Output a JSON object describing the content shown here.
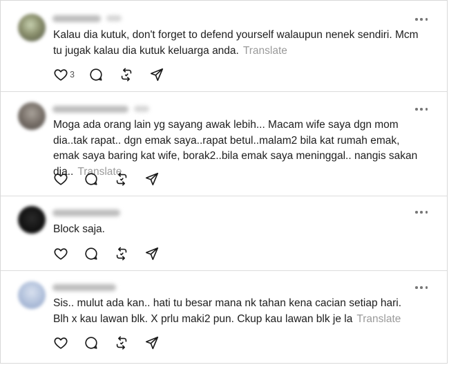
{
  "comments": [
    {
      "text": "Kalau dia kutuk, don't forget to defend yourself walaupun nenek sendiri. Mcm tu jugak kalau dia kutuk keluarga anda.",
      "translate": "Translate",
      "likes": "3"
    },
    {
      "text": "Moga ada orang lain yg sayang awak lebih... Macam wife saya dgn mom dia..tak rapat.. dgn emak saya..rapat betul..malam2 bila kat rumah emak, emak saya baring kat wife, borak2..bila emak saya meninggal.. nangis sakan dia..",
      "translate": "Translate"
    },
    {
      "text": "Block saja."
    },
    {
      "text": "Sis.. mulut ada kan.. hati tu besar mana nk tahan kena cacian setiap hari. Blh x kau lawan blk. X prlu maki2 pun. Ckup kau lawan blk je la",
      "translate": "Translate"
    }
  ],
  "icons": {
    "like": "heart-icon",
    "reply": "comment-icon",
    "repost": "repost-icon",
    "share": "send-icon",
    "more": "more-icon"
  },
  "colors": {
    "text": "#1d1d1d",
    "translate": "#9a9a9a",
    "icon": "#1a1a1a",
    "divider": "#dcdcdc"
  }
}
